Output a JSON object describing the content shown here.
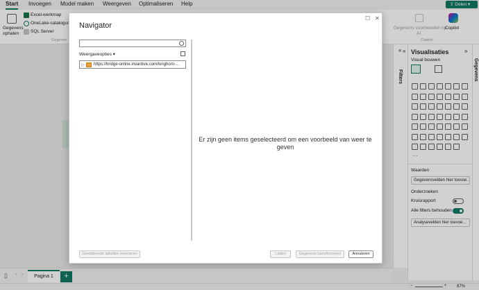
{
  "menu": {
    "tabs": [
      "Start",
      "Invoegen",
      "Model maken",
      "Weergeven",
      "Optimaliseren",
      "Help"
    ],
    "share_label": "Delen"
  },
  "ribbon": {
    "get_data_line1": "Gegevens",
    "get_data_line2": "ophalen",
    "excel": "Excel-werkmap",
    "onelake": "OneLake-catalogus",
    "sql": "SQL Server",
    "group_label": "Gegeven",
    "preview_ai_line1": "Gegevens voorbeelden op",
    "preview_ai_line2": "AI",
    "copilot": "Copilot",
    "copilot_group": "Copilot"
  },
  "navigator": {
    "title": "Navigator",
    "search_placeholder": "",
    "view_options": "Weergaveopties",
    "tree_items": [
      "https://bridge-online.invantive.com/longhorn-..."
    ],
    "empty_message": "Er zijn geen items geselecteerd om een voorbeeld van weer te geven",
    "btn_select_related": "Gerelateerde tabellen selecteren",
    "btn_load": "Laden",
    "btn_transform": "Gegevens transformeren",
    "btn_cancel": "Annuleren"
  },
  "panes": {
    "filters": "Filters",
    "visualizations": "Visualisaties",
    "build_visual": "Visual bouwen",
    "data": "Gegevens",
    "values_label": "Waarden",
    "values_placeholder": "Gegevensvelden hier toevoe...",
    "drill_label": "Onderzoeken",
    "cross_report": "Kruisrapport",
    "keep_filters": "Alle filters behouden",
    "drill_placeholder": "Analysevelden hier toevoe...",
    "more": "···"
  },
  "bottom": {
    "page_tab": "Pagina 1",
    "add_page": "+",
    "zoom": "87%"
  },
  "colors": {
    "accent": "#117865"
  }
}
